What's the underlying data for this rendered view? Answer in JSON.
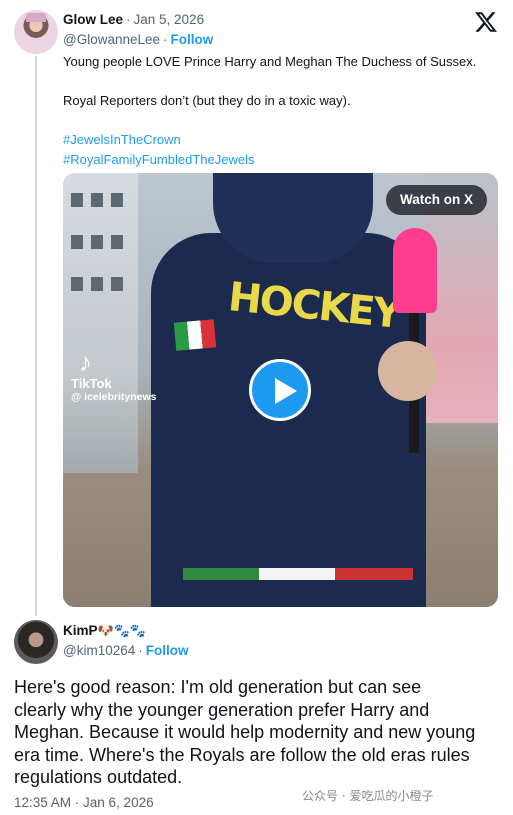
{
  "tweet1": {
    "name": "Glow Lee",
    "date": "Jan 5, 2026",
    "handle": "@GlowanneLee",
    "follow": "Follow",
    "lines": [
      "Young people LOVE Prince Harry and Meghan The Duchess of Sussex.",
      "Royal Reporters don’t (but they do in a toxic way)."
    ],
    "hashtags": [
      "#JewelsInTheCrown",
      "#RoyalFamilyFumbledTheJewels"
    ],
    "media": {
      "watch_label": "Watch on X",
      "tiktok_name": "TikTok",
      "tiktok_handle": "@ icelebritynews",
      "video_text": "HOCKEY"
    }
  },
  "tweet2": {
    "name": "KimP",
    "name_emoji": "🐶🐾🐾",
    "handle": "@kim10264",
    "follow": "Follow",
    "lines": [
      "Here's good reason: I'm old generation  but can see",
      "clearly why the younger generation prefer Harry and",
      "Meghan. Because it would help modernity and new young",
      "era time. Where's the Royals are follow  the old eras rules",
      "regulations outdated."
    ],
    "time": "12:35 AM · Jan 6, 2026"
  },
  "watermark": "公众号 · 爱吃瓜的小橙子",
  "icons": {
    "x_logo": "x-logo-icon",
    "play": "play-icon",
    "tiktok": "tiktok-icon"
  },
  "colors": {
    "accent": "#1d9bf0",
    "text": "#0f1419",
    "muted": "#536471"
  }
}
